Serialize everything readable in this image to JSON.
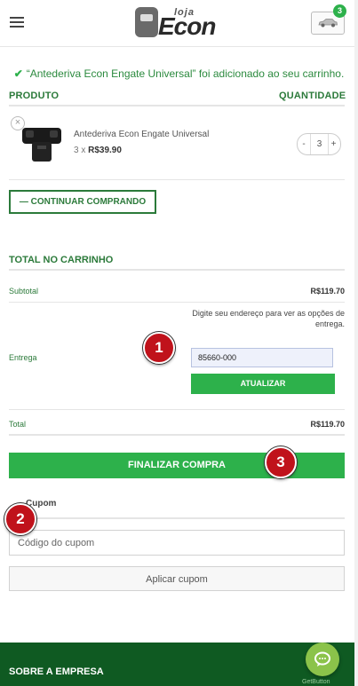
{
  "header": {
    "logo_top": "loja",
    "logo_main": "Econ",
    "cart_count": "3"
  },
  "notice": {
    "text": "“Antederiva Econ Engate Universal” foi adicionado ao seu carrinho."
  },
  "cart_table": {
    "col_product": "PRODUTO",
    "col_quantity": "QUANTIDADE",
    "items": [
      {
        "remove": "×",
        "name": "Antederiva Econ Engate Universal",
        "qty_prefix": "3 x ",
        "price": "R$39.90",
        "quantity": "3",
        "minus": "-",
        "plus": "+"
      }
    ]
  },
  "continue_button": "— CONTINUAR COMPRANDO",
  "totals": {
    "title": "TOTAL NO CARRINHO",
    "subtotal_label": "Subtotal",
    "subtotal_value": "R$119.70",
    "shipping_note": "Digite seu endereço para ver as opções de entrega.",
    "shipping_label": "Entrega",
    "cep_value": "85660-000",
    "update_button": "ATUALIZAR",
    "total_label": "Total",
    "total_value": "R$119.70"
  },
  "checkout_button": "FINALIZAR COMPRA",
  "coupon": {
    "title": "Cupom",
    "placeholder": "Código do cupom",
    "apply_button": "Aplicar cupom"
  },
  "footer": {
    "title": "SOBRE A EMPRESA",
    "getbutton_label": "GetButton"
  },
  "markers": [
    "1",
    "2",
    "3"
  ],
  "colors": {
    "accent_green": "#2db14b",
    "heading_green": "#2b7a3a",
    "footer_green": "#0f5a22",
    "marker_red": "#c0121b"
  }
}
